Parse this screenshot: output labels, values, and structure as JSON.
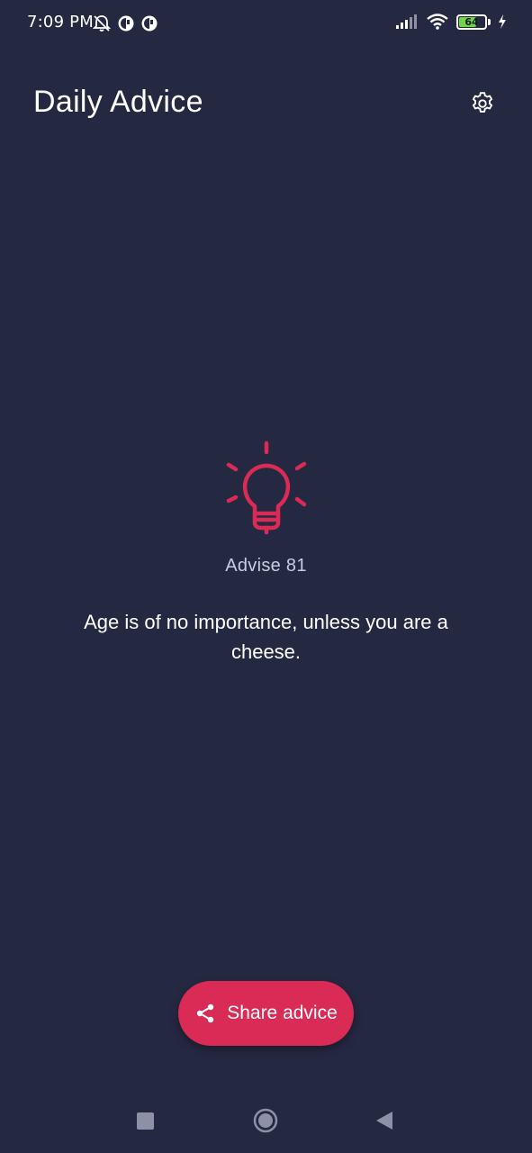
{
  "status_bar": {
    "time": "7:09 PM",
    "battery_level": "64",
    "icons": [
      "mute-icon",
      "app-notification-icon",
      "app-notification-icon",
      "signal-icon",
      "wifi-icon",
      "battery-icon",
      "charging-icon"
    ]
  },
  "header": {
    "title": "Daily Advice",
    "settings_icon": "gear-icon"
  },
  "advice": {
    "icon": "lightbulb-icon",
    "number_label": "Advise 81",
    "text": "Age is of no importance, unless you are a cheese."
  },
  "actions": {
    "share_label": "Share advice",
    "share_icon": "share-icon"
  },
  "nav": {
    "recents_icon": "square-icon",
    "home_icon": "circle-icon",
    "back_icon": "triangle-back-icon"
  },
  "colors": {
    "background": "#252841",
    "accent": "#d92b55",
    "secondary_text": "#c9cce0"
  }
}
